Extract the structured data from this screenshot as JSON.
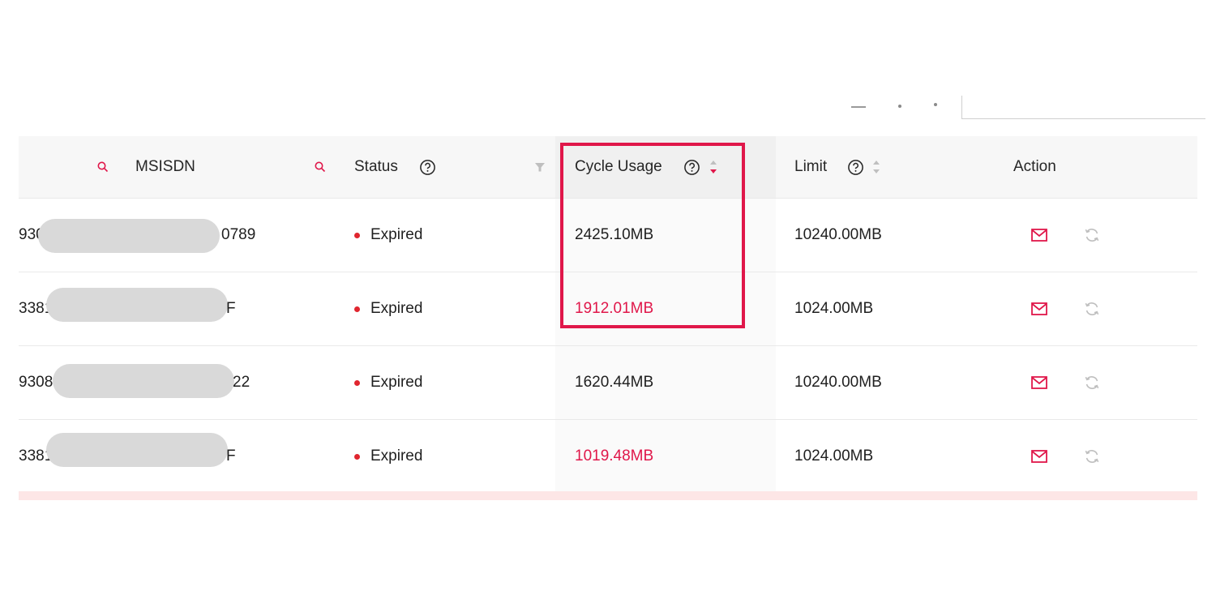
{
  "columns": {
    "msisdn": "MSISDN",
    "status": "Status",
    "cycle_usage": "Cycle Usage",
    "limit": "Limit",
    "action": "Action"
  },
  "rows": [
    {
      "msisdn_prefix": "930",
      "msisdn_suffix": "0789",
      "status": "Expired",
      "cycle_usage": "2425.10MB",
      "cycle_usage_over_limit": false,
      "limit": "10240.00MB"
    },
    {
      "msisdn_prefix": "3381",
      "msisdn_suffix": "F",
      "status": "Expired",
      "cycle_usage": "1912.01MB",
      "cycle_usage_over_limit": true,
      "limit": "1024.00MB"
    },
    {
      "msisdn_prefix": "93089",
      "msisdn_suffix": "22",
      "status": "Expired",
      "cycle_usage": "1620.44MB",
      "cycle_usage_over_limit": false,
      "limit": "10240.00MB"
    },
    {
      "msisdn_prefix": "3381",
      "msisdn_suffix": "F",
      "status": "Expired",
      "cycle_usage": "1019.48MB",
      "cycle_usage_over_limit": true,
      "limit": "1024.00MB"
    }
  ],
  "icons": {
    "search": "search-icon",
    "help": "help-circle-icon",
    "sort": "sort-icon",
    "filter": "filter-icon",
    "send": "mail-icon",
    "refresh": "refresh-icon"
  },
  "colors": {
    "accent": "#e0174a",
    "status_expired": "#e0262f",
    "redaction": "#d9d9d9"
  }
}
